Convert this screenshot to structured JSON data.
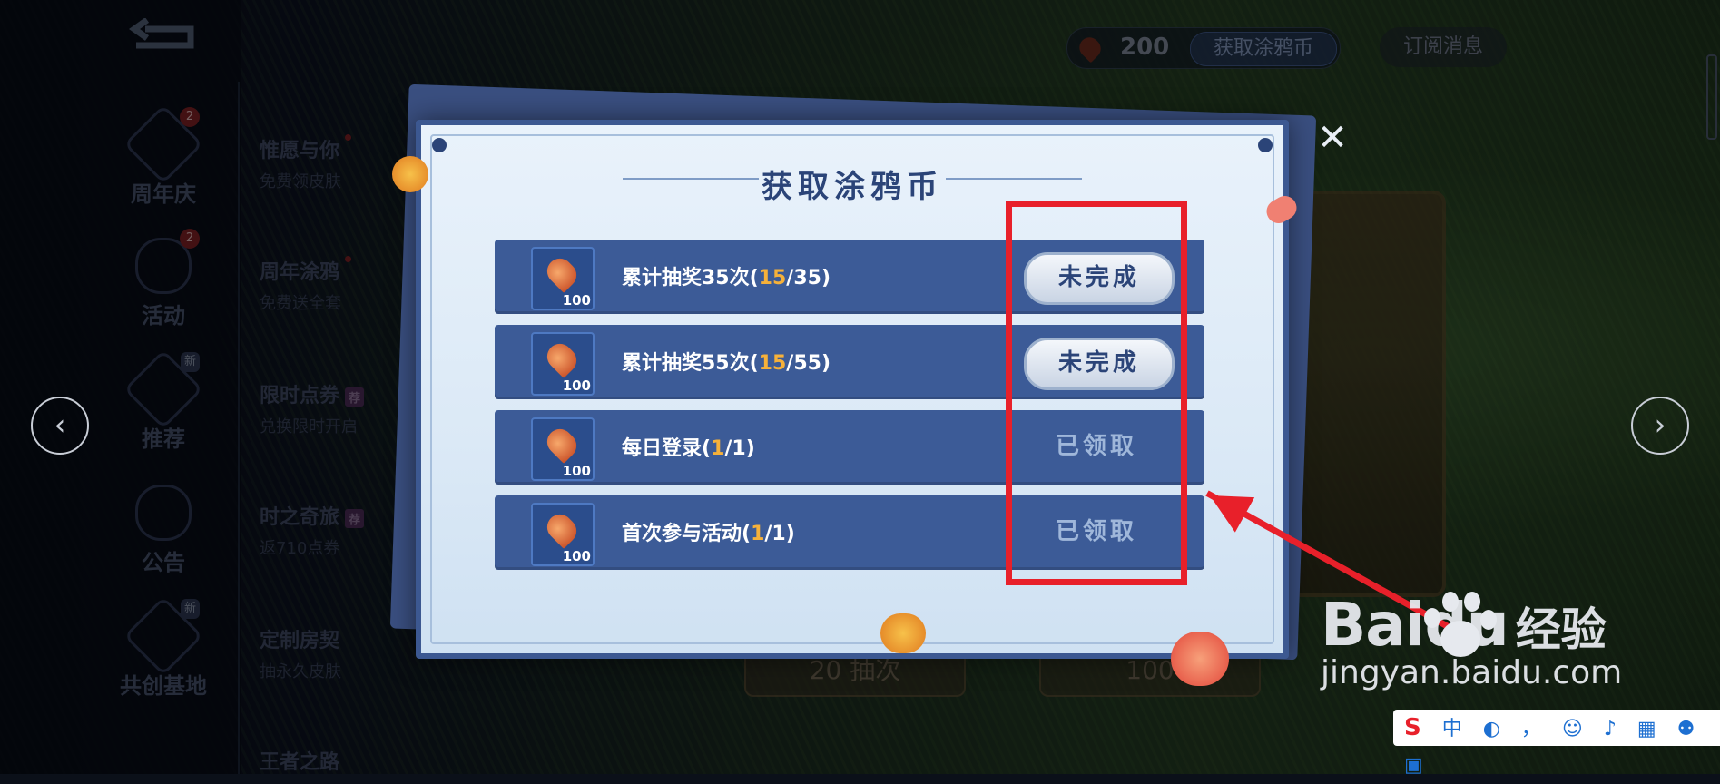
{
  "sidebar": {
    "categories": [
      {
        "label": "周年庆",
        "badge": "2",
        "icon": "anniversary-icon"
      },
      {
        "label": "活动",
        "badge": "2",
        "icon": "gift-icon"
      },
      {
        "label": "推荐",
        "badge": "新",
        "icon": "flame-icon"
      },
      {
        "label": "公告",
        "badge": "",
        "icon": "notice-icon"
      },
      {
        "label": "共创基地",
        "badge": "新",
        "icon": "cocreate-icon"
      }
    ],
    "items": [
      {
        "title": "惟愿与你",
        "desc": "免费领皮肤",
        "tag": ""
      },
      {
        "title": "周年涂鸦",
        "desc": "免费送全套",
        "tag": ""
      },
      {
        "title": "限时点券",
        "desc": "兑换限时开启",
        "tag": "荐"
      },
      {
        "title": "时之奇旅",
        "desc": "返710点券",
        "tag": "荐"
      },
      {
        "title": "定制房契",
        "desc": "抽永久皮肤",
        "tag": ""
      },
      {
        "title": "王者之路",
        "desc": "",
        "tag": ""
      }
    ]
  },
  "topbar": {
    "coin_count": "200",
    "get_coin_label": "获取涂鸦币",
    "subscribe_label": "订阅消息"
  },
  "modal": {
    "title": "获取涂鸦币",
    "tasks": [
      {
        "text_prefix": "累计抽奖35次(",
        "current": "15",
        "text_suffix": "/35)",
        "reward": "100",
        "status": "未完成",
        "done": false
      },
      {
        "text_prefix": "累计抽奖55次(",
        "current": "15",
        "text_suffix": "/55)",
        "reward": "100",
        "status": "未完成",
        "done": false
      },
      {
        "text_prefix": "每日登录(",
        "current": "1",
        "text_suffix": "/1)",
        "reward": "100",
        "status": "已领取",
        "done": true
      },
      {
        "text_prefix": "首次参与活动(",
        "current": "1",
        "text_suffix": "/1)",
        "reward": "100",
        "status": "已领取",
        "done": true
      }
    ]
  },
  "background": {
    "pill_left": "20 抽次",
    "pill_right": "100"
  },
  "watermark": {
    "logo": "Baidu",
    "cn": "经验",
    "url": "jingyan.baidu.com"
  },
  "ime_bar": {
    "text": "中 ◐ ， ☺ ♪ ▦ ⚉ ▣"
  },
  "colors": {
    "annotation_red": "#e8202a",
    "modal_blue": "#3c5b97",
    "progress_orange": "#f6b13a"
  }
}
